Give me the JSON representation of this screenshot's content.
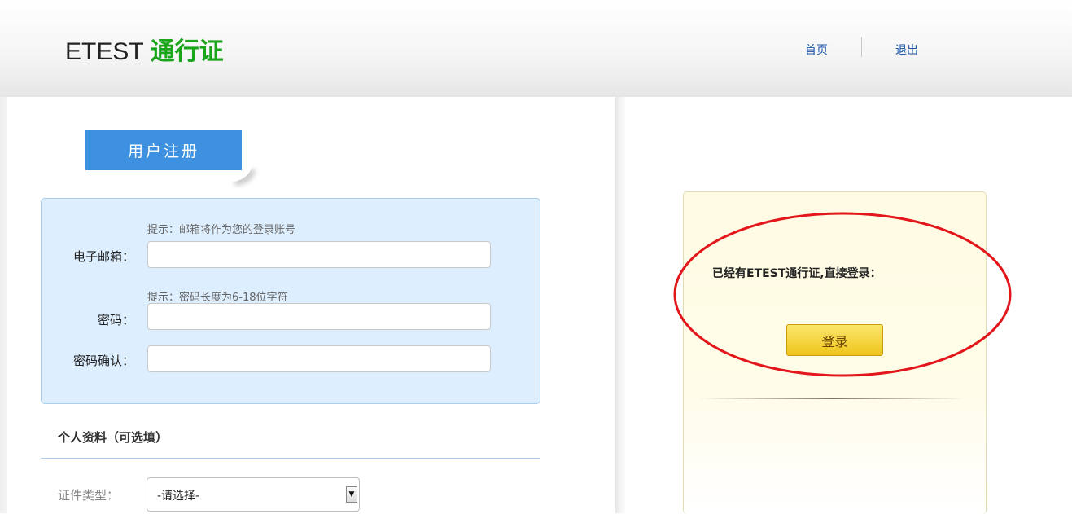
{
  "header": {
    "logo_brand": "ETEST",
    "logo_tag": "通行证",
    "nav": {
      "home": "首页",
      "logout": "退出"
    }
  },
  "register": {
    "tab_title": "用户注册",
    "email": {
      "hint": "提示：邮箱将作为您的登录账号",
      "label": "电子邮箱：",
      "value": "",
      "placeholder": ""
    },
    "password": {
      "hint": "提示：密码长度为6-18位字符",
      "label": "密码：",
      "value": "",
      "placeholder": ""
    },
    "password_confirm": {
      "label": "密码确认：",
      "value": "",
      "placeholder": ""
    }
  },
  "profile": {
    "section_title": "个人资料（可选填）",
    "id_type": {
      "label": "证件类型：",
      "selected": "-请选择-"
    }
  },
  "login": {
    "prompt": "已经有ETEST通行证,直接登录：",
    "button": "登录"
  },
  "colors": {
    "brand_green": "#1aa51a",
    "tab_blue": "#3d91e0",
    "annotation_red": "#e3161b"
  }
}
